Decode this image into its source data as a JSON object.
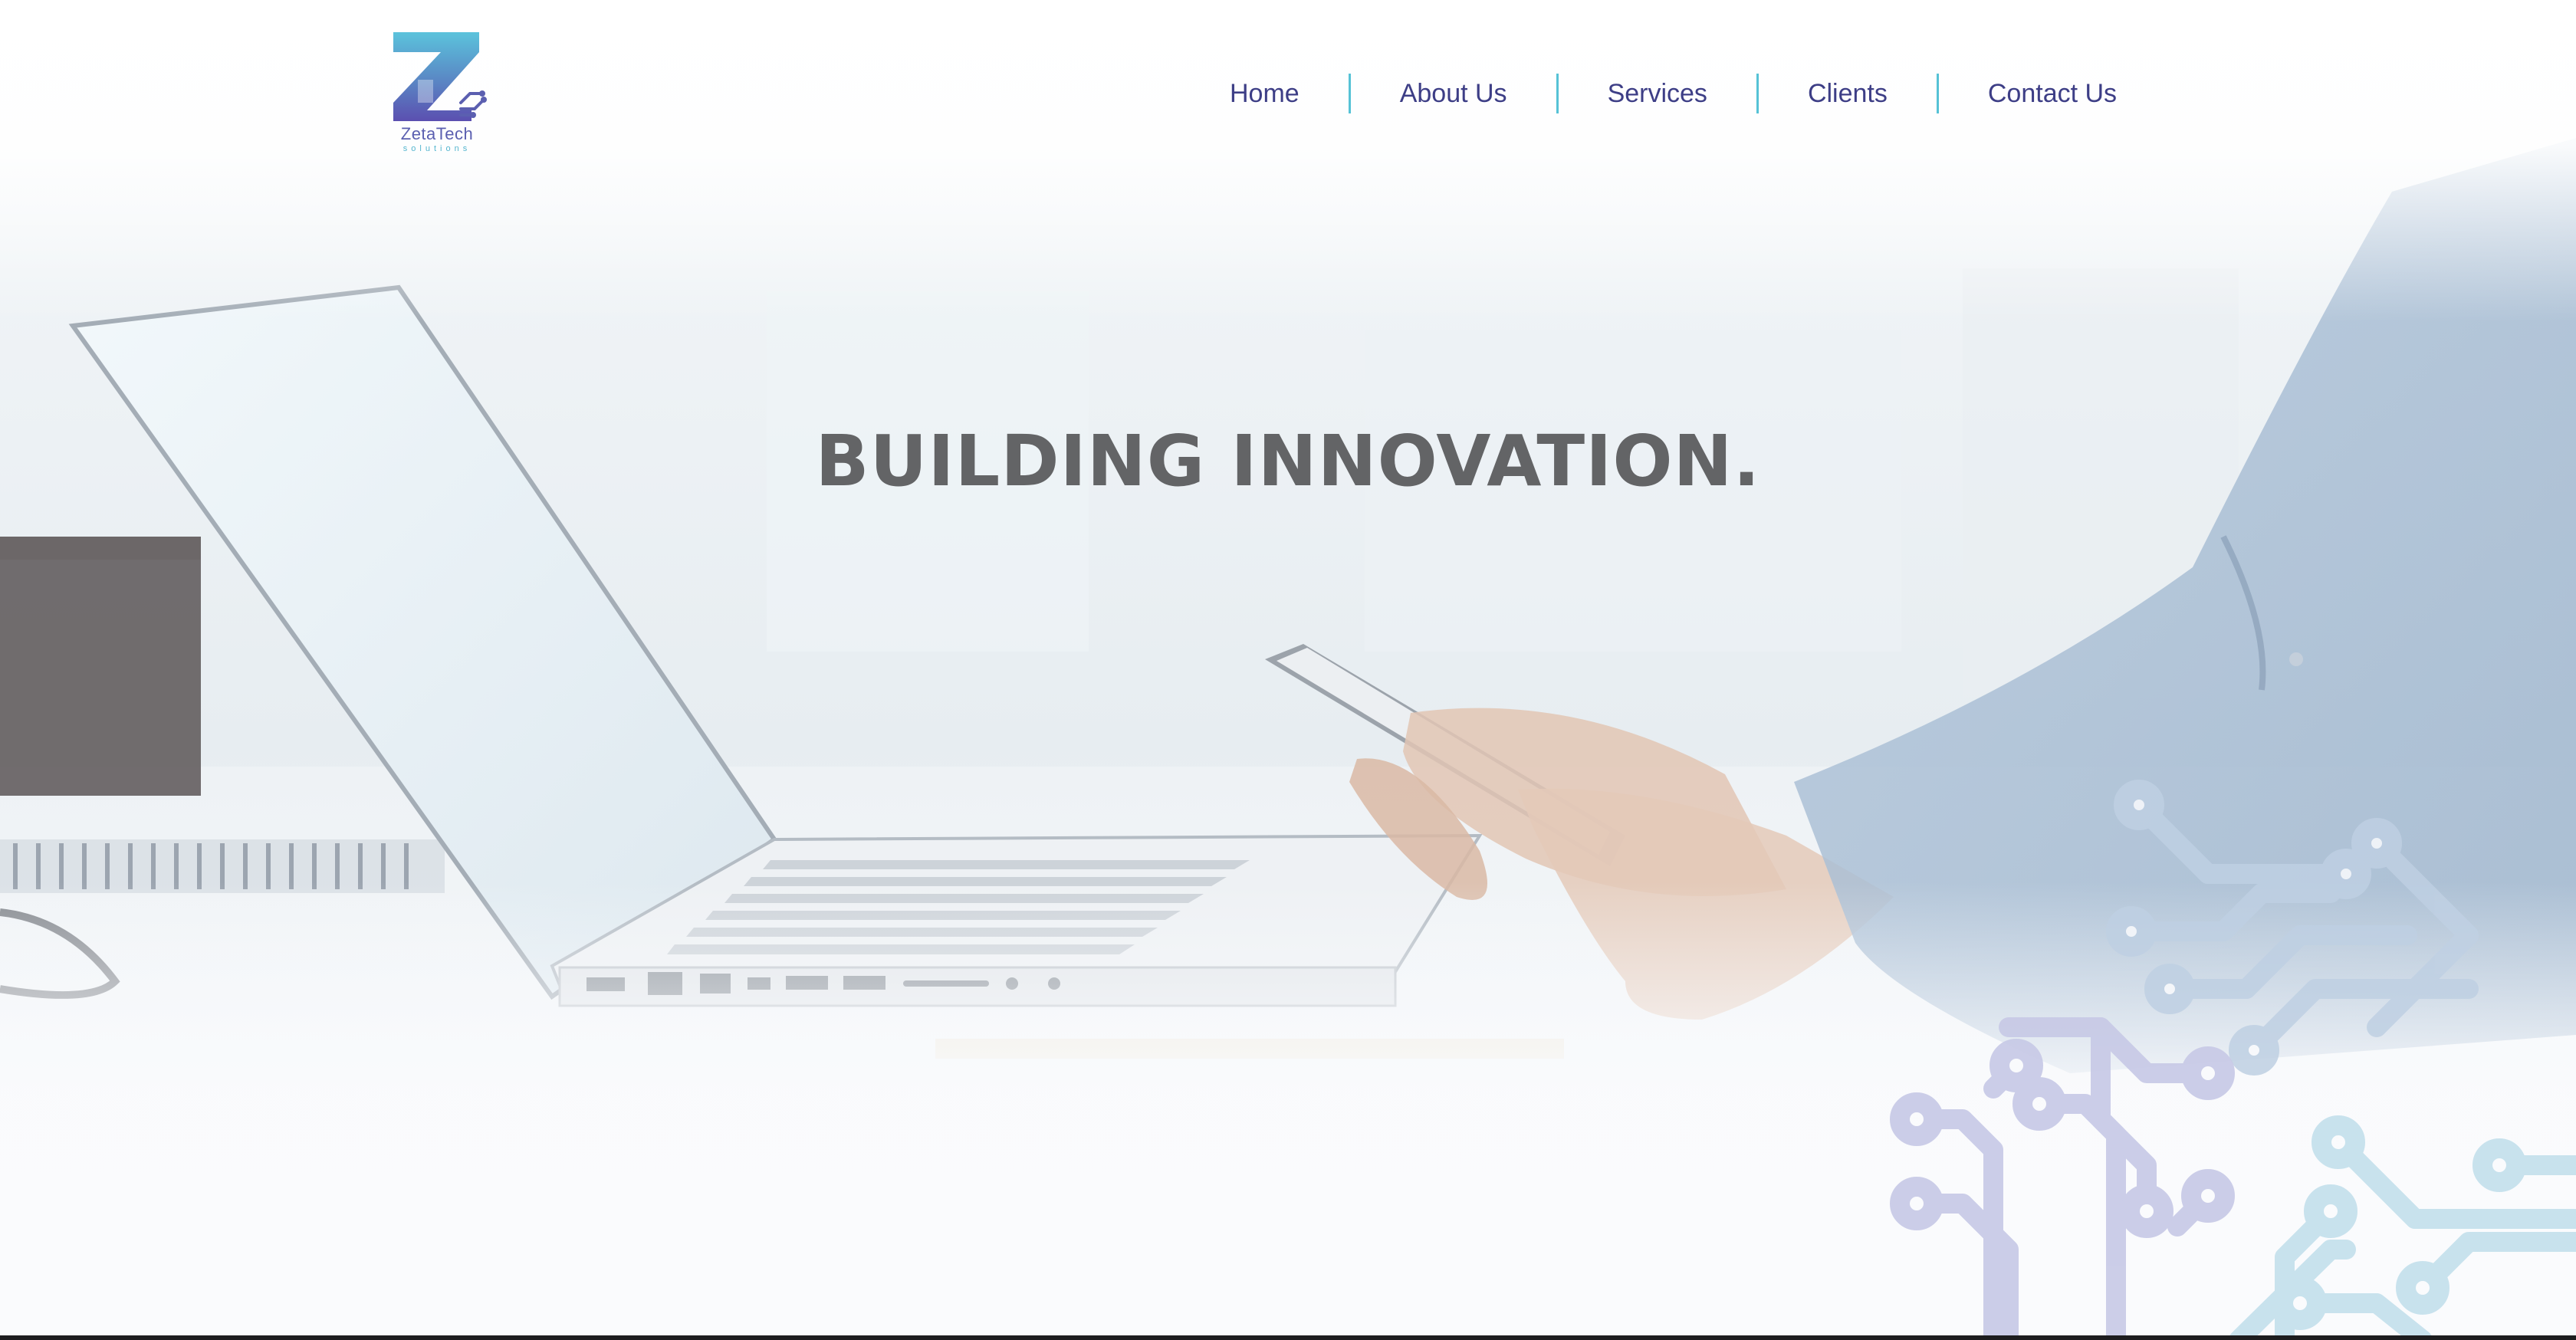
{
  "brand": {
    "name": "ZetaTech",
    "tagline": "solutions",
    "colors": {
      "primary": "#3d3e86",
      "accent": "#56c2d6",
      "gradient_start": "#5bc3dc",
      "gradient_end": "#5b4fb0"
    }
  },
  "nav": {
    "items": [
      {
        "label": "Home"
      },
      {
        "label": "About Us"
      },
      {
        "label": "Services"
      },
      {
        "label": "Clients"
      },
      {
        "label": "Contact Us"
      }
    ]
  },
  "hero": {
    "title": "BUILDING INNOVATION.",
    "title_color": "#636466",
    "background_image": "laptop-and-smartphone-photo",
    "decoration": "circuit-trace-graphic"
  }
}
